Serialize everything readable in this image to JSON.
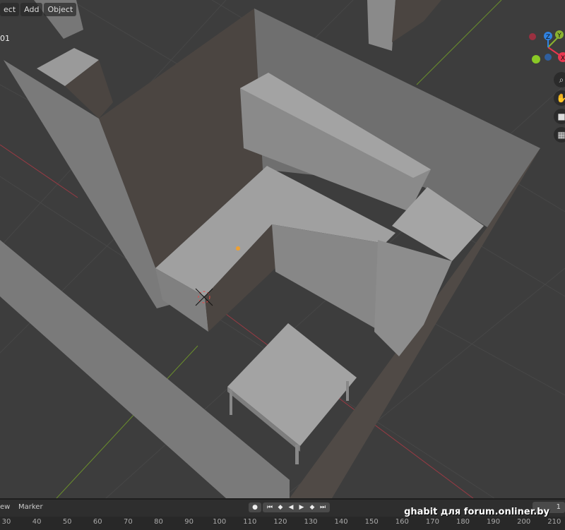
{
  "header": {
    "menus": [
      "ect",
      "Add",
      "Object"
    ]
  },
  "object_name": "01",
  "gizmo": {
    "z": "Z",
    "y": "Y",
    "x": "X",
    "colors": {
      "x": "#e8364f",
      "y": "#8ab32f",
      "z": "#2f83e3"
    }
  },
  "nav_icons": [
    "zoom-icon",
    "hand-pan-icon",
    "camera-icon",
    "grid-ortho-icon"
  ],
  "timeline": {
    "menus": [
      "ew",
      "Marker"
    ],
    "current_frame": "1",
    "ticks": [
      "30",
      "40",
      "50",
      "60",
      "70",
      "80",
      "90",
      "100",
      "110",
      "120",
      "130",
      "140",
      "150",
      "160",
      "170",
      "180",
      "190",
      "200",
      "210"
    ]
  },
  "watermark": "ghabit для forum.onliner.by"
}
